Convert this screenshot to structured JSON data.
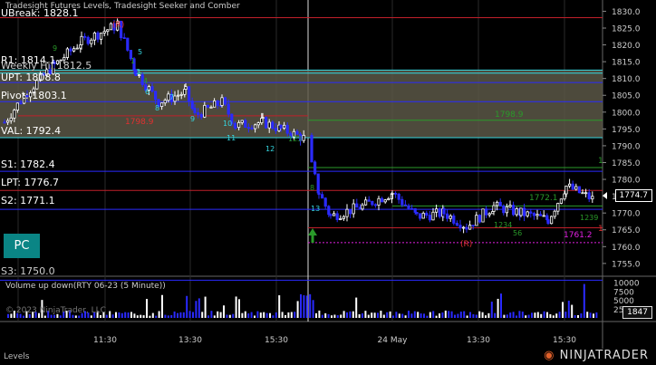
{
  "window": {
    "title": "Tradesight Futures Levels, Tradesight Seeker and Comber",
    "footer_tab": "Levels",
    "brand": "NINJATRADER"
  },
  "levels": {
    "ubreak": "UBreak: 1828.1",
    "r1": "R1: 1814.1",
    "overlap_a": "Weekly Hi: 1812.5",
    "upt": "UPT: 1808.8",
    "pivot": "Pivot: 1803.1",
    "val": "VAL: 1792.4",
    "s1": "S1: 1782.4",
    "lpt": "LPT: 1776.7",
    "s2": "S2: 1771.1",
    "low_overlap": "S3: 1750.0"
  },
  "pc_button": "PC",
  "annotations": {
    "r_top": "(R)",
    "r_bottom": "(R)",
    "red_level": "1798.9",
    "green_level": "1798.9",
    "mid_level": "1772.1",
    "magenta_level": "1761.2",
    "one_top": "1",
    "one_bottom": "1"
  },
  "price_axis": {
    "ticks": [
      "1830.0",
      "1825.0",
      "1820.0",
      "1815.0",
      "1810.0",
      "1805.0",
      "1800.0",
      "1795.0",
      "1790.0",
      "1785.0",
      "1780.0",
      "1775.0",
      "1770.0",
      "1765.0",
      "1760.0",
      "1755.0"
    ],
    "current": "1774.7"
  },
  "time_axis": {
    "ticks": [
      "11:30",
      "13:30",
      "15:30",
      "24 May",
      "13:30",
      "15:30"
    ]
  },
  "volume": {
    "title": "Volume up down(RTY 06-23 (5 Minute))",
    "ticks": [
      "10000",
      "7500",
      "5000",
      "2500"
    ],
    "current": "1847",
    "copyright": "© 2023 NinjaTrader, LLC"
  },
  "colors": {
    "background": "#000000",
    "up_bar": "#ffffff",
    "down_bar": "#2a2aff",
    "zone_fill": "#5a5747",
    "cyan": "#35d6e0",
    "red": "#c0202a",
    "green": "#2a9a2a",
    "magenta": "#e020e0",
    "blue_line": "#2a2aff"
  },
  "chart_data": {
    "type": "candlestick",
    "ylim": [
      1752,
      1832
    ],
    "x_sessions": [
      "11:30",
      "13:30",
      "15:30",
      "24 May",
      "13:30",
      "15:30"
    ]
  }
}
